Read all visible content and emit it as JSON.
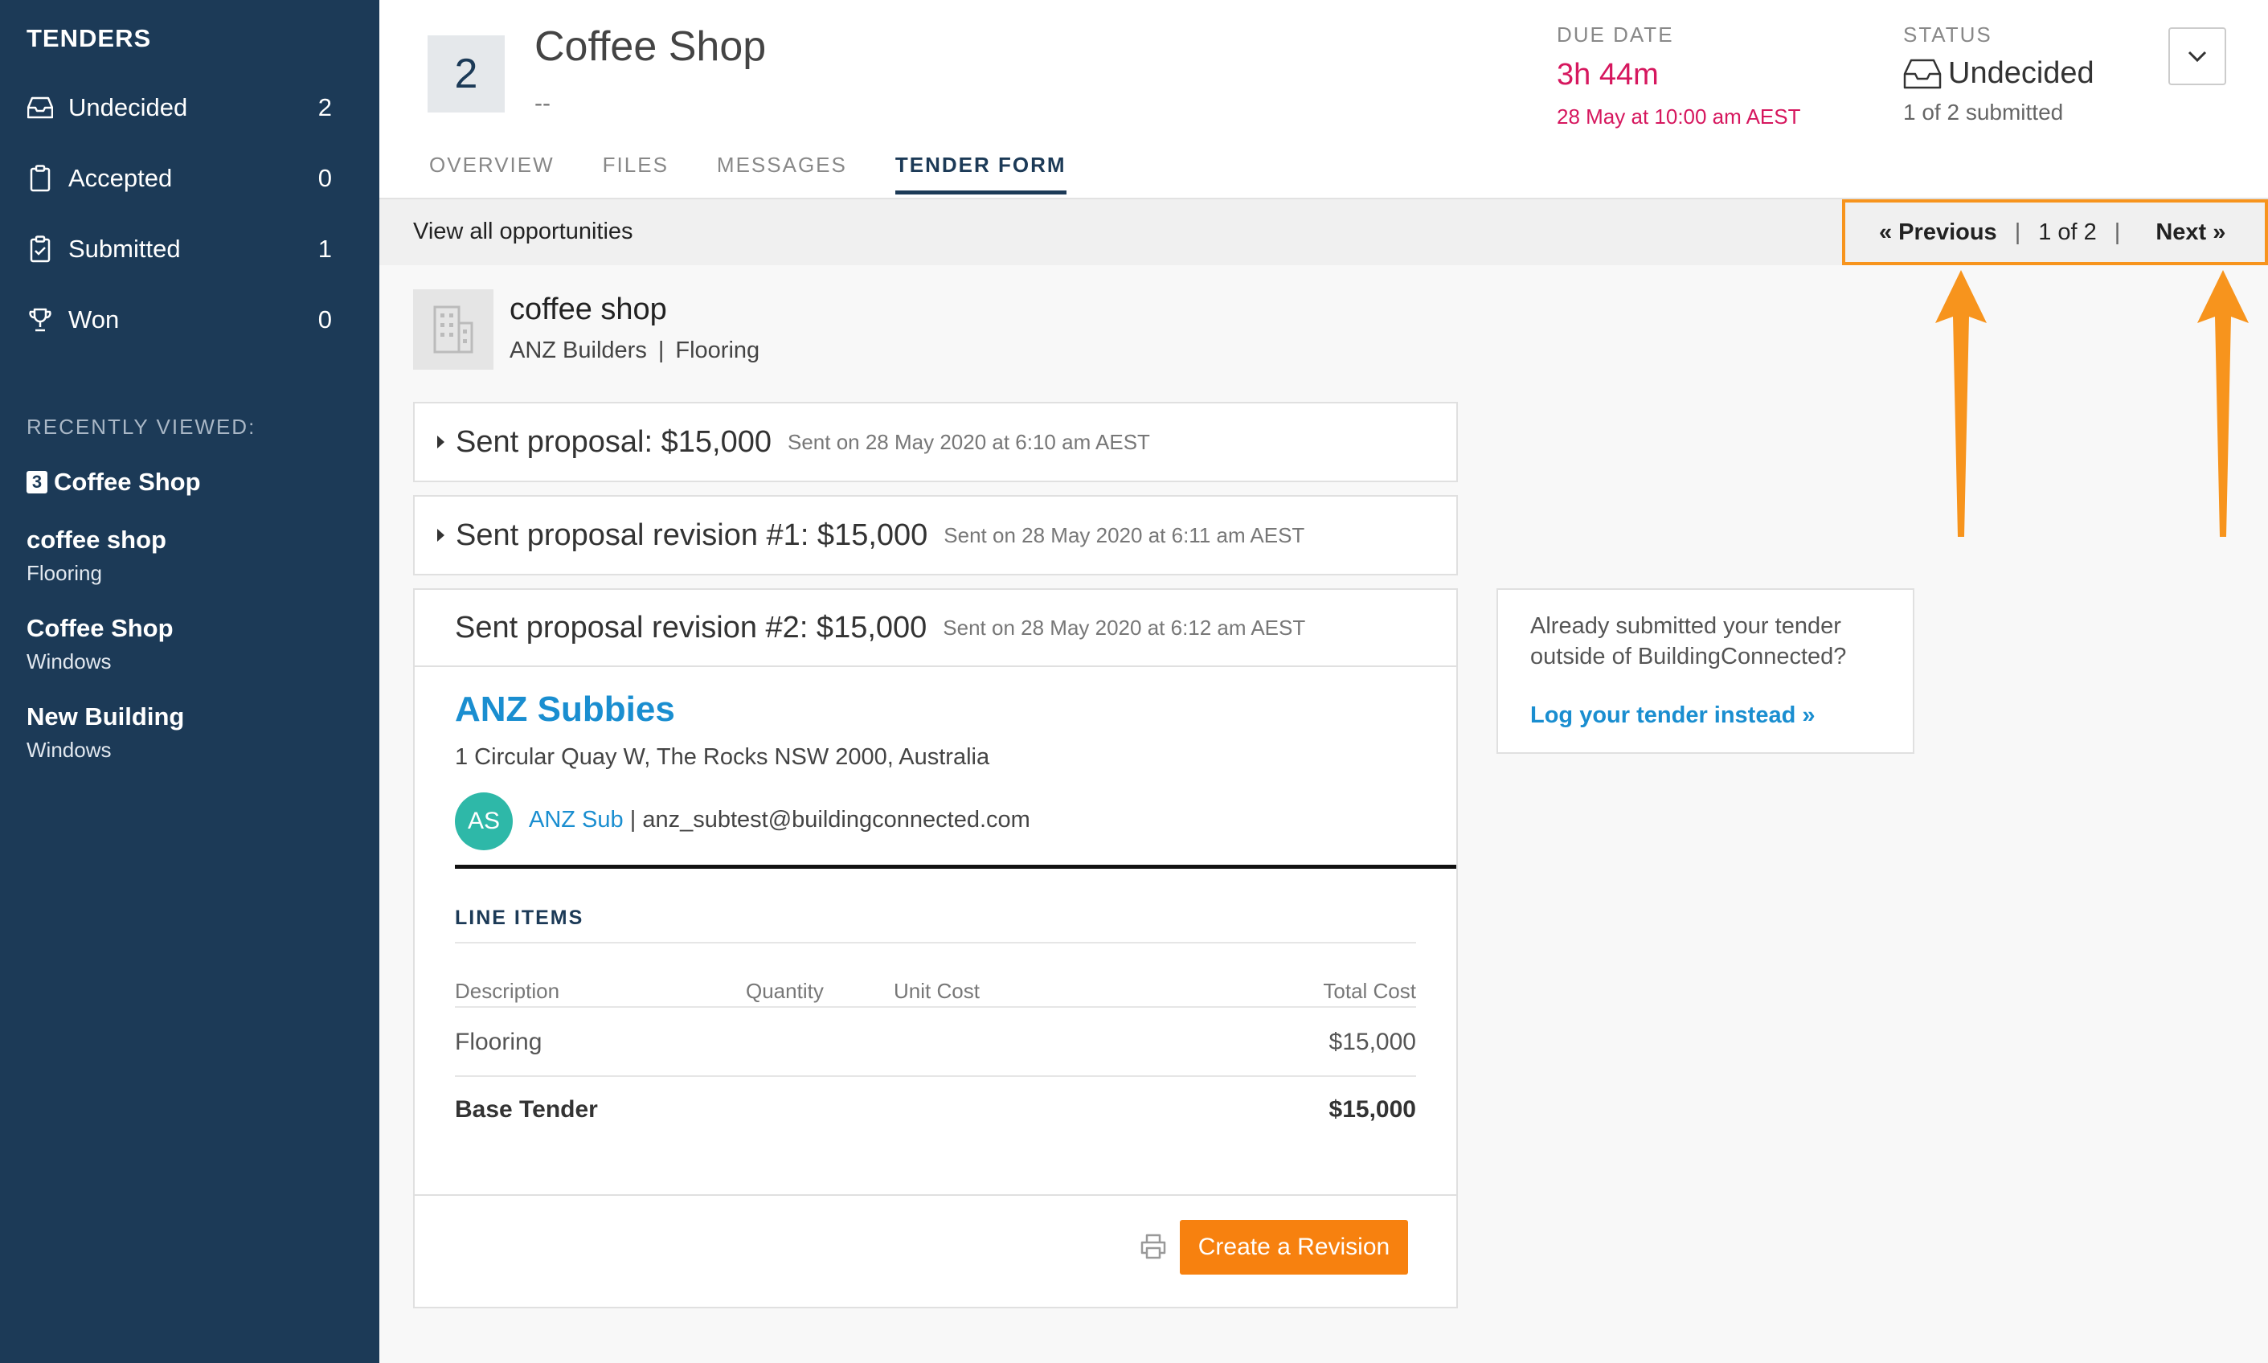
{
  "sidebar": {
    "title": "TENDERS",
    "items": [
      {
        "label": "Undecided",
        "count": "2"
      },
      {
        "label": "Accepted",
        "count": "0"
      },
      {
        "label": "Submitted",
        "count": "1"
      },
      {
        "label": "Won",
        "count": "0"
      }
    ],
    "recent_title": "RECENTLY VIEWED:",
    "recent": [
      {
        "badge": "3",
        "title": "Coffee Shop",
        "sub": ""
      },
      {
        "title": "coffee shop",
        "sub": "Flooring"
      },
      {
        "title": "Coffee Shop",
        "sub": "Windows"
      },
      {
        "title": "New Building",
        "sub": "Windows"
      }
    ]
  },
  "header": {
    "number": "2",
    "title": "Coffee Shop",
    "subtitle": "--",
    "due_label": "DUE DATE",
    "due_time": "3h 44m",
    "due_date": "28 May at 10:00 am AEST",
    "status_label": "STATUS",
    "status_value": "Undecided",
    "status_sub": "1 of 2 submitted"
  },
  "tabs": [
    {
      "label": "OVERVIEW"
    },
    {
      "label": "FILES"
    },
    {
      "label": "MESSAGES"
    },
    {
      "label": "TENDER FORM"
    }
  ],
  "bar": {
    "view_all": "View all opportunities",
    "prev": "« Previous",
    "position": "1 of 2",
    "next": "Next »"
  },
  "project": {
    "name": "coffee shop",
    "company": "ANZ Builders",
    "trade": "Flooring"
  },
  "proposals": [
    {
      "title": "Sent proposal: $15,000",
      "date": "Sent on 28 May 2020 at 6:10 am AEST"
    },
    {
      "title": "Sent proposal revision #1: $15,000",
      "date": "Sent on 28 May 2020 at 6:11 am AEST"
    },
    {
      "title": "Sent proposal revision #2: $15,000",
      "date": "Sent on 28 May 2020 at 6:12 am AEST"
    }
  ],
  "bidder": {
    "company": "ANZ Subbies",
    "address": "1 Circular Quay W, The Rocks NSW 2000, Australia",
    "initials": "AS",
    "contact_name": "ANZ Sub",
    "contact_email": "anz_subtest@buildingconnected.com"
  },
  "line_items": {
    "title": "LINE ITEMS",
    "headers": {
      "description": "Description",
      "quantity": "Quantity",
      "unit_cost": "Unit Cost",
      "total_cost": "Total Cost"
    },
    "rows": [
      {
        "description": "Flooring",
        "total": "$15,000"
      }
    ],
    "base_label": "Base Tender",
    "base_total": "$15,000"
  },
  "actions": {
    "create_revision": "Create a Revision"
  },
  "side_box": {
    "question": "Already submitted your tender outside of BuildingConnected?",
    "link": "Log your tender instead »"
  },
  "colors": {
    "sidebar_bg": "#1c3a57",
    "accent_blue": "#1a8ed0",
    "due_red": "#d6175e",
    "orange": "#f7810f",
    "highlight": "#f7941d"
  }
}
